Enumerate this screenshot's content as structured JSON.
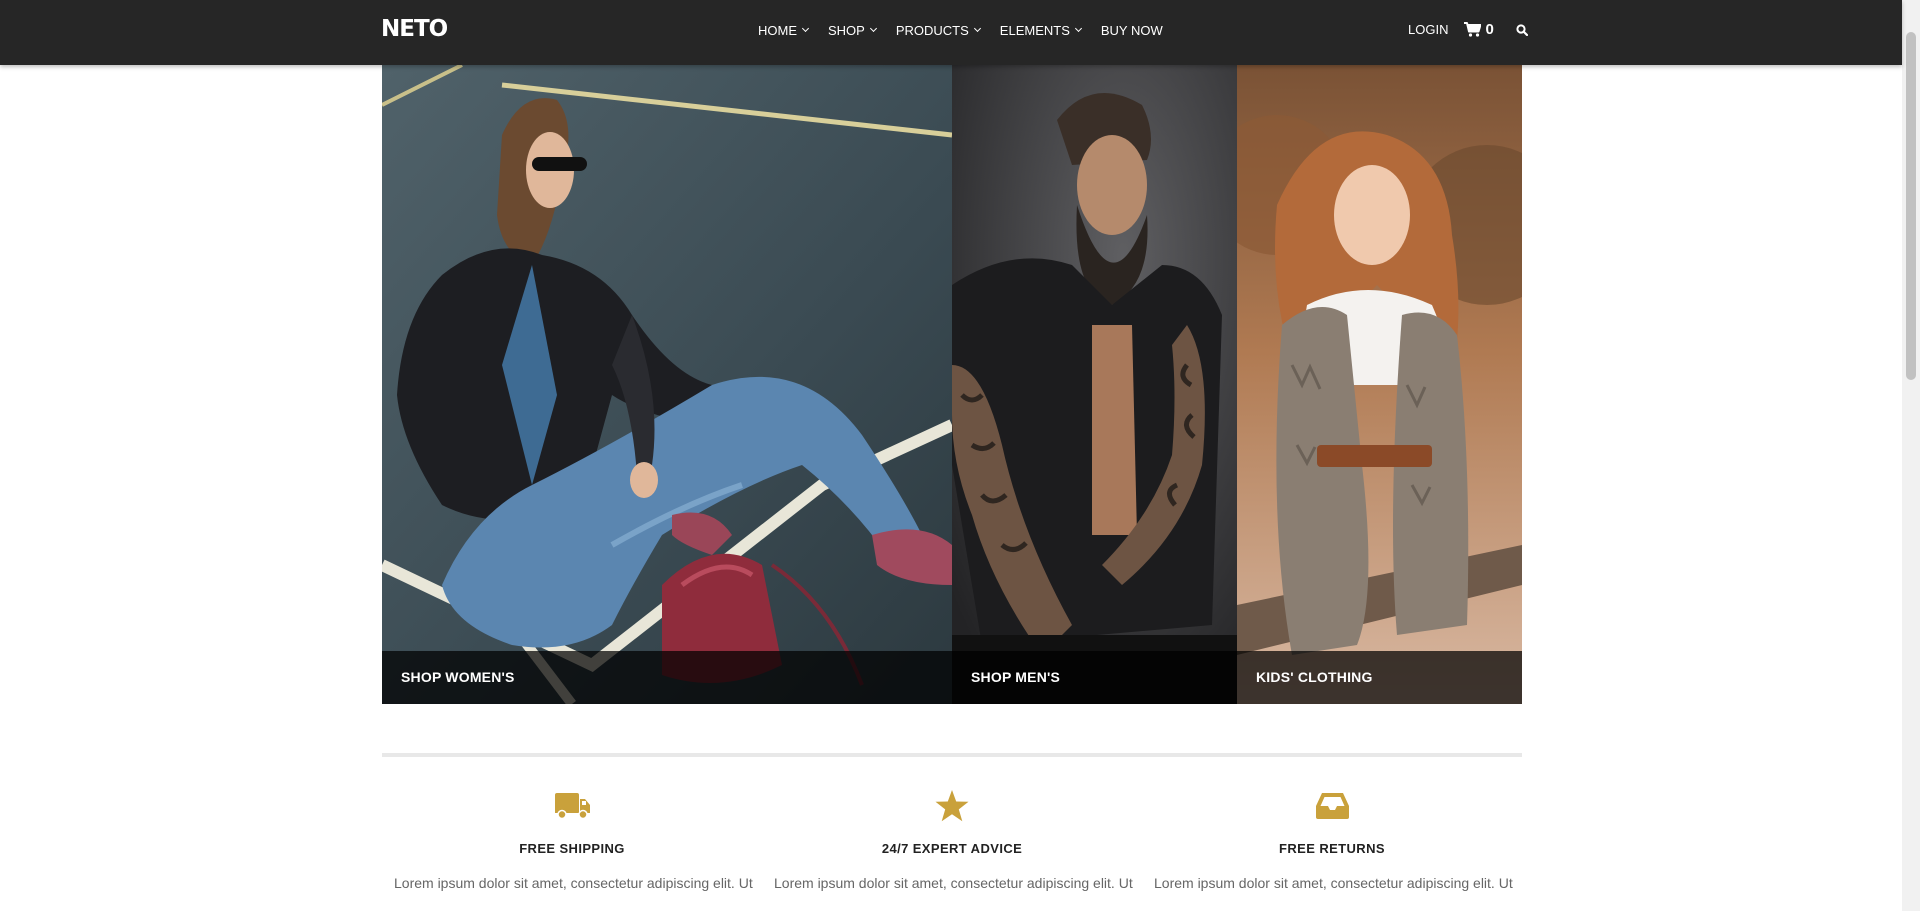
{
  "brand": "NETO",
  "nav": {
    "menu": [
      {
        "label": "HOME",
        "dropdown": true
      },
      {
        "label": "SHOP",
        "dropdown": true
      },
      {
        "label": "PRODUCTS",
        "dropdown": true
      },
      {
        "label": "ELEMENTS",
        "dropdown": true
      },
      {
        "label": "BUY NOW",
        "dropdown": false
      }
    ],
    "login": "LOGIN",
    "cart_count": "0",
    "cart_icon": "shopping-cart-icon",
    "search_icon": "search-icon"
  },
  "banners": [
    {
      "caption": "SHOP WOMEN'S"
    },
    {
      "caption": "SHOP MEN'S"
    },
    {
      "caption": "KIDS' CLOTHING"
    }
  ],
  "features": [
    {
      "icon": "truck-icon",
      "title": "FREE SHIPPING",
      "text": "Lorem ipsum dolor sit amet, consectetur adipiscing elit. Ut"
    },
    {
      "icon": "star-icon",
      "title": "24/7 EXPERT ADVICE",
      "text": "Lorem ipsum dolor sit amet, consectetur adipiscing elit. Ut"
    },
    {
      "icon": "inbox-icon",
      "title": "FREE RETURNS",
      "text": "Lorem ipsum dolor sit amet, consectetur adipiscing elit. Ut"
    }
  ],
  "colors": {
    "accent": "#c9a13b",
    "navbar": "#262626"
  }
}
